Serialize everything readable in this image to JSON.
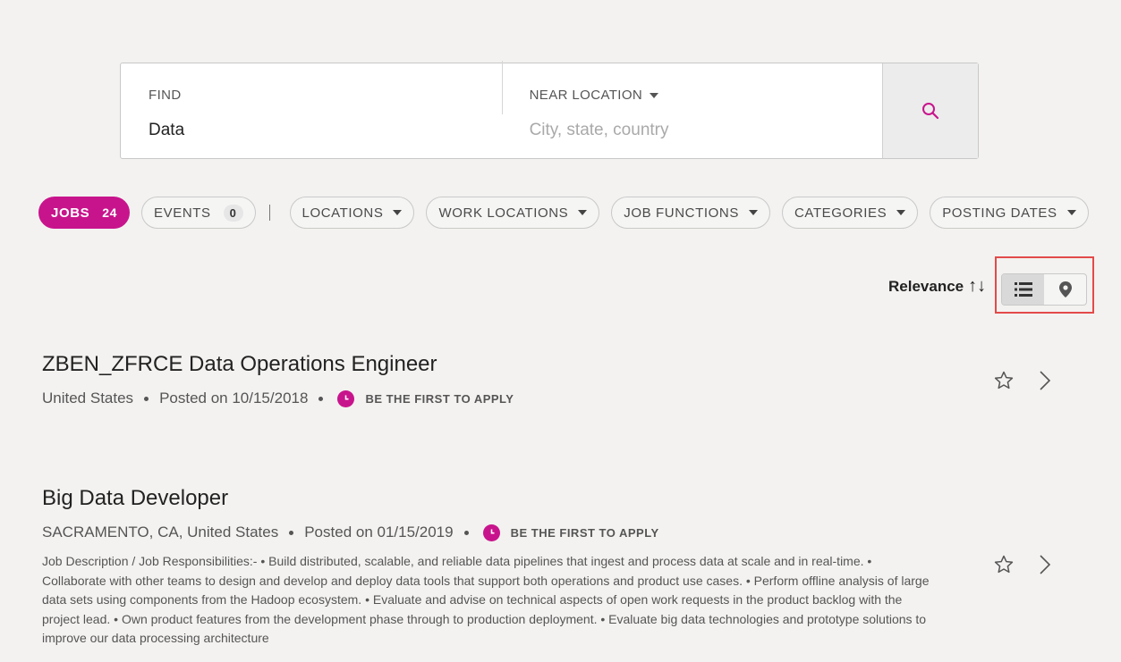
{
  "search": {
    "find_label": "FIND",
    "find_value": "Data",
    "near_label": "NEAR LOCATION",
    "near_placeholder": "City, state, country"
  },
  "filters": {
    "jobs": {
      "label": "JOBS",
      "count": "24"
    },
    "events": {
      "label": "EVENTS",
      "count": "0"
    },
    "dropdowns": [
      "LOCATIONS",
      "WORK LOCATIONS",
      "JOB FUNCTIONS",
      "CATEGORIES",
      "POSTING DATES"
    ]
  },
  "sort": {
    "label": "Relevance",
    "icon": "↑↓"
  },
  "jobs": [
    {
      "title": "ZBEN_ZFRCE Data Operations Engineer",
      "location": "United States",
      "posted": "Posted on 10/15/2018",
      "tag": "BE THE FIRST TO APPLY"
    },
    {
      "title": "Big Data Developer",
      "location": "SACRAMENTO, CA, United States",
      "posted": "Posted on 01/15/2019",
      "tag": "BE THE FIRST TO APPLY",
      "description": "Job Description / Job Responsibilities:- • Build distributed, scalable, and reliable data pipelines that ingest and process data at scale and in real-time. • Collaborate with other teams to design and develop and deploy data tools that support both operations and product use cases. • Perform offline analysis of large data sets using components from the Hadoop ecosystem. • Evaluate and advise on technical aspects of open work requests in the product backlog with the project lead. • Own product features from the development phase through to production deployment. • Evaluate big data technologies and prototype solutions to improve our data processing architecture"
    }
  ],
  "colors": {
    "accent": "#c8148c",
    "highlight": "#e34a4a"
  }
}
